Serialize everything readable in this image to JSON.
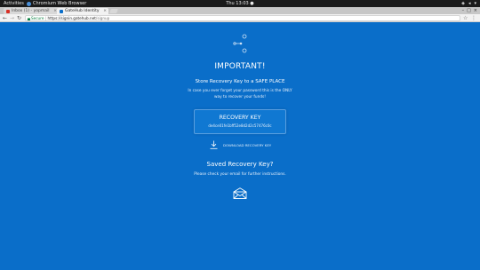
{
  "system_bar": {
    "activities": "Activities",
    "app_name": "Chromium Web Browser",
    "clock": "Thu 13:03 ●",
    "status_icons": [
      "network-icon",
      "volume-icon",
      "power-icon"
    ]
  },
  "browser": {
    "tabs": [
      {
        "label": "Inbox (1) - yopmail",
        "active": false,
        "favicon_color": "#d93025"
      },
      {
        "label": "GateHub Identity",
        "active": true,
        "favicon_color": "#0a6ec9"
      }
    ],
    "address": {
      "secure_label": "Secure",
      "separator": " | ",
      "host": "https://signin.gatehub.net",
      "path": "/signup"
    }
  },
  "page": {
    "heading": "IMPORTANT!",
    "subheading": "Store Recovery Key to a SAFE PLACE",
    "description_lines": [
      "In case you ever forget your password this is the ONLY",
      "way to recover your funds!"
    ],
    "recovery_key_label": "RECOVERY KEY",
    "recovery_key_value": "de4ce01fe1bff52e8d2d2c57476c0c",
    "download_label": "DOWNLOAD RECOVERY KEY",
    "saved_heading": "Saved Recovery Key?",
    "saved_description": "Please check your email for further instructions.",
    "colors": {
      "background": "#0a6ec9",
      "text": "#ffffff"
    }
  }
}
